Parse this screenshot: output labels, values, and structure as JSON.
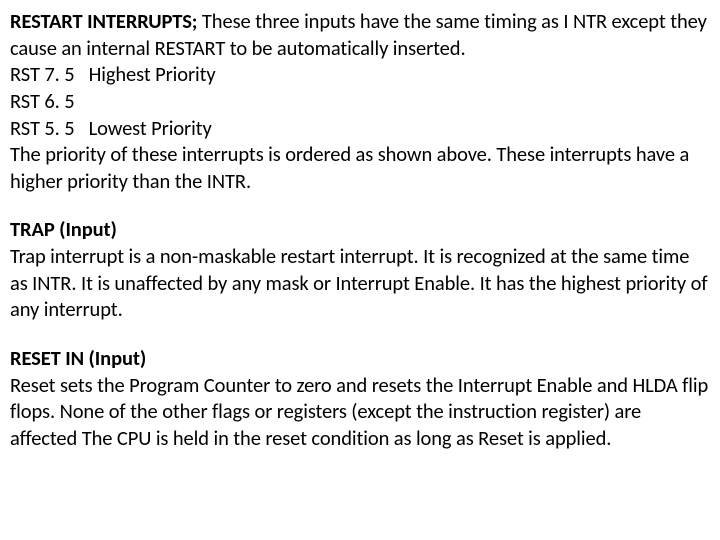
{
  "section1": {
    "title": "RESTART INTERRUPTS;",
    "text_a": " These three inputs have the same timing as I NTR except they cause an internal RESTART to be automatically inserted.",
    "rst75_label": "RST 7. 5",
    "rst75_pri": "Highest Priority",
    "rst65_label": "RST 6. 5",
    "rst55_label": "RST 5. 5",
    "rst55_pri": "Lowest Priority",
    "text_b": "The priority of these interrupts is ordered as shown above. These interrupts have a higher priority than the INTR."
  },
  "section2": {
    "title": "TRAP (Input)",
    "text": "Trap interrupt is a non-maskable restart interrupt. It is recognized at the same time as INTR. It is unaffected by any mask or Interrupt Enable. It has the highest priority of any interrupt."
  },
  "section3": {
    "title": "RESET IN (Input)",
    "text": "Reset sets the Program Counter to zero and resets the Interrupt Enable and HLDA flip flops. None of the other flags or registers (except the instruction register) are affected The CPU is held in the reset condition as long as Reset is applied."
  }
}
